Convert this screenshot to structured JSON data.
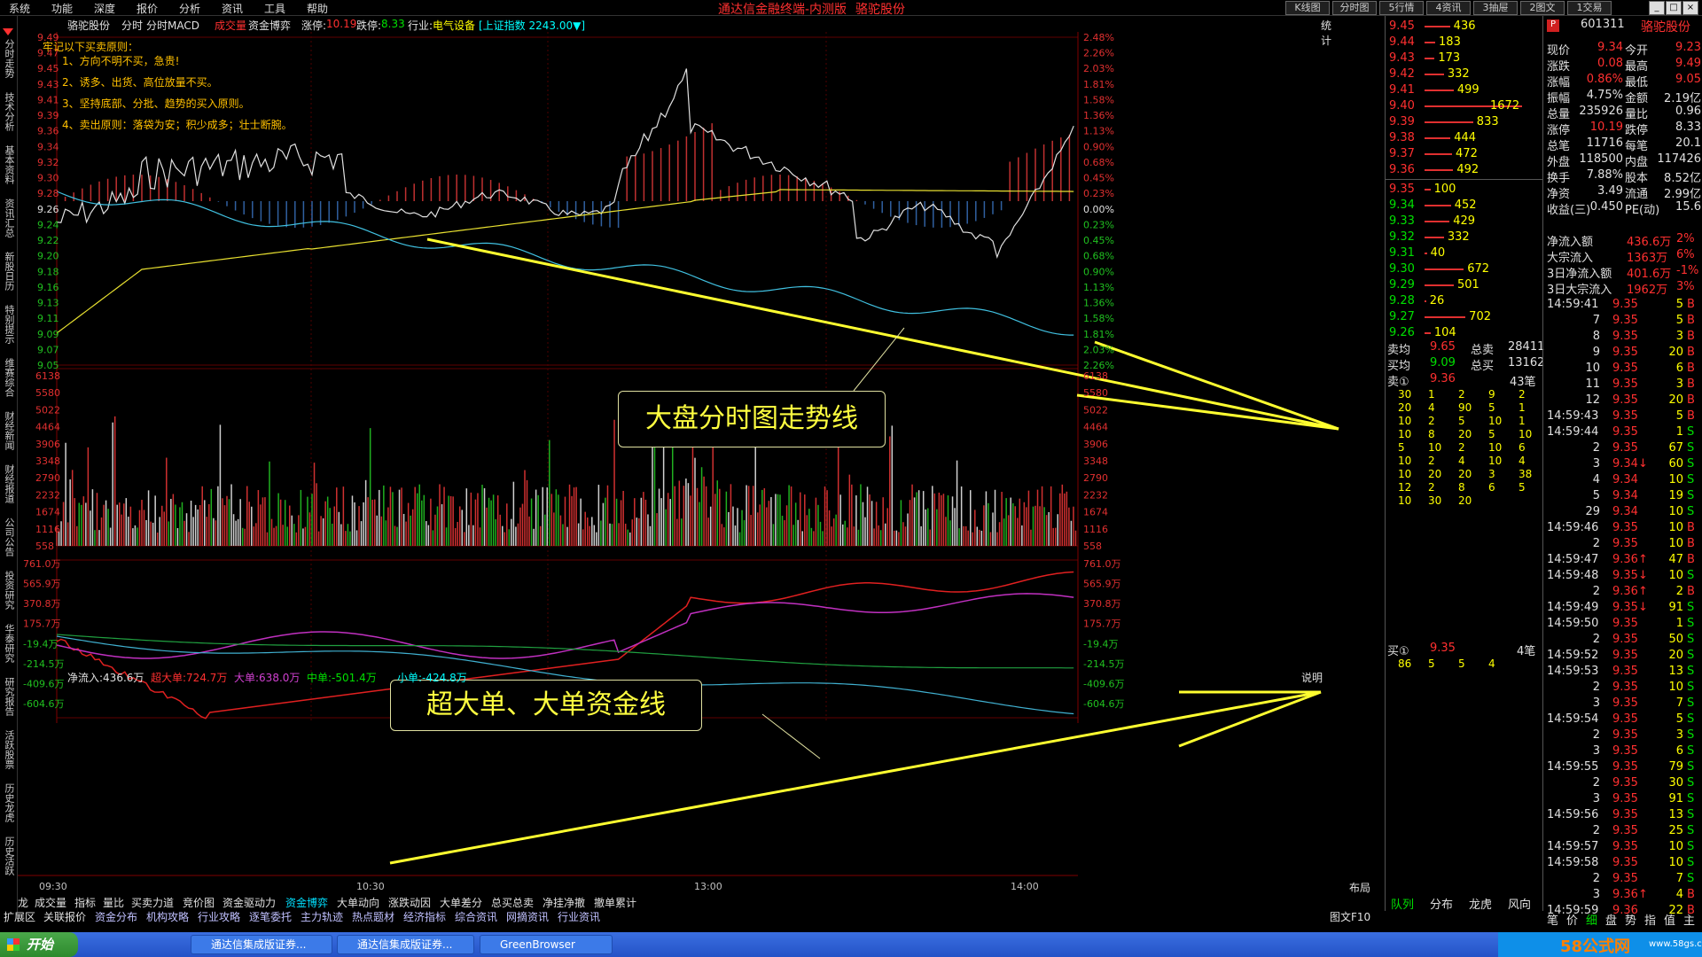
{
  "menu": [
    "系统",
    "功能",
    "深度",
    "报价",
    "分析",
    "资讯",
    "工具",
    "帮助"
  ],
  "window_title": "通达信金融终端-内测版",
  "window_stock": "骆驼股份",
  "toolbar_buttons": [
    "K线图",
    "分时图",
    "5行情",
    "4资讯",
    "3抽屉",
    "2图文",
    "1交易"
  ],
  "leftnav": [
    "分时走势",
    "技术分析",
    "基本资料",
    "资讯汇总",
    "新股日历",
    "特别提示",
    "维赛综合",
    "财经新闻",
    "财经报道",
    "公司公告",
    "投资研究",
    "华泰研究",
    "研究报告",
    "活跃股票",
    "历史龙虎",
    "历史活跃"
  ],
  "chart_header": {
    "stock": "骆驼股份",
    "items": [
      "分时",
      "分时MACD"
    ],
    "labels": [
      "成交量",
      "资金博弈"
    ],
    "zhangting_label": "涨停:",
    "zhangting": "10.19",
    "dieting_label": "跌停:",
    "dieting": "8.33",
    "industry_label": "行业:",
    "industry": "电气设备",
    "index_label": "[上证指数 2243.00▼]",
    "stats": "统计"
  },
  "annotations": {
    "title": "牢记以下买卖原则：",
    "lines": [
      "1、方向不明不买，急贵!",
      "2、诱多、出货、高位放量不买。",
      "3、坚持底部、分批、趋势的买入原则。",
      "4、卖出原则：落袋为安；积少成多；壮士断腕。"
    ]
  },
  "callouts": {
    "upper": "大盘分时图走势线",
    "lower": "超大单、大单资金线"
  },
  "price_axis": [
    "9.49",
    "9.47",
    "9.45",
    "9.43",
    "9.41",
    "9.39",
    "9.36",
    "9.34",
    "9.32",
    "9.30",
    "9.28",
    "9.26",
    "9.24",
    "9.22",
    "9.20",
    "9.18",
    "9.16",
    "9.13",
    "9.11",
    "9.09",
    "9.07",
    "9.05"
  ],
  "pct_axis": [
    "2.48%",
    "2.26%",
    "2.03%",
    "1.81%",
    "1.58%",
    "1.36%",
    "1.13%",
    "0.90%",
    "0.68%",
    "0.45%",
    "0.23%",
    "0.00%",
    "0.23%",
    "0.45%",
    "0.68%",
    "0.90%",
    "1.13%",
    "1.36%",
    "1.58%",
    "1.81%",
    "2.03%",
    "2.26%"
  ],
  "vol_axis": [
    "6138",
    "5580",
    "5022",
    "4464",
    "3906",
    "3348",
    "2790",
    "2232",
    "1674",
    "1116",
    "558"
  ],
  "flow_header": {
    "net": "净流入:436.6万",
    "super": "超大单:724.7万",
    "big": "大单:638.0万",
    "mid": "中单:-501.4万",
    "small": "小单:-424.8万",
    "explain": "说明"
  },
  "flow_axis": [
    "761.0万",
    "565.9万",
    "370.8万",
    "175.7万",
    "-19.4万",
    "-214.5万",
    "-409.6万",
    "-604.6万"
  ],
  "time_axis": [
    "09:30",
    "10:30",
    "13:00",
    "14:00"
  ],
  "layout_label": "布局",
  "order_book": {
    "sell": [
      [
        "9.45",
        "436"
      ],
      [
        "9.44",
        "183"
      ],
      [
        "9.43",
        "173"
      ],
      [
        "9.42",
        "332"
      ],
      [
        "9.41",
        "499"
      ],
      [
        "9.40",
        "1672"
      ],
      [
        "9.39",
        "833"
      ],
      [
        "9.38",
        "444"
      ],
      [
        "9.37",
        "472"
      ],
      [
        "9.36",
        "492"
      ]
    ],
    "buy": [
      [
        "9.35",
        "100"
      ],
      [
        "9.34",
        "452"
      ],
      [
        "9.33",
        "429"
      ],
      [
        "9.32",
        "332"
      ],
      [
        "9.31",
        "40"
      ],
      [
        "9.30",
        "672"
      ],
      [
        "9.29",
        "501"
      ],
      [
        "9.28",
        "26"
      ],
      [
        "9.27",
        "702"
      ],
      [
        "9.26",
        "104"
      ]
    ],
    "sell_avg_label": "卖均",
    "sell_avg": "9.65",
    "total_sell_label": "总卖",
    "total_sell": "28411",
    "buy_avg_label": "买均",
    "buy_avg": "9.09",
    "total_buy_label": "总买",
    "total_buy": "13162",
    "sell1_label": "卖①",
    "sell1_price": "9.36",
    "sell1_count": "43笔",
    "sell1_queue": [
      [
        "30",
        "1",
        "2",
        "9",
        "2"
      ],
      [
        "20",
        "4",
        "90",
        "5",
        "1"
      ],
      [
        "10",
        "2",
        "5",
        "10",
        "1"
      ],
      [
        "10",
        "8",
        "20",
        "5",
        "10"
      ],
      [
        "5",
        "10",
        "2",
        "10",
        "6"
      ],
      [
        "10",
        "2",
        "4",
        "10",
        "4"
      ],
      [
        "10",
        "20",
        "20",
        "3",
        "38"
      ],
      [
        "12",
        "2",
        "8",
        "6",
        "5"
      ],
      [
        "10",
        "30",
        "20",
        "",
        ""
      ]
    ],
    "buy1_label": "买①",
    "buy1_price": "9.35",
    "buy1_count": "4笔",
    "buy1_queue": [
      [
        "86",
        "5",
        "5",
        "4"
      ]
    ]
  },
  "quote": {
    "code": "601311",
    "name": "骆驼股份",
    "fields": [
      [
        "现价",
        "9.34",
        "今开",
        "9.23"
      ],
      [
        "涨跌",
        "0.08",
        "最高",
        "9.49"
      ],
      [
        "涨幅",
        "0.86%",
        "最低",
        "9.05"
      ],
      [
        "振幅",
        "4.75%",
        "金额",
        "2.19亿"
      ],
      [
        "总量",
        "235926",
        "量比",
        "0.96"
      ],
      [
        "涨停",
        "10.19",
        "跌停",
        "8.33"
      ],
      [
        "总笔",
        "11716",
        "每笔",
        "20.1"
      ],
      [
        "外盘",
        "118500",
        "内盘",
        "117426"
      ],
      [
        "换手",
        "7.88%",
        "股本",
        "8.52亿"
      ],
      [
        "净资",
        "3.49",
        "流通",
        "2.99亿"
      ],
      [
        "收益(三)",
        "0.450",
        "PE(动)",
        "15.6"
      ]
    ],
    "flows": [
      [
        "净流入额",
        "436.6万",
        "2%"
      ],
      [
        "大宗流入",
        "1363万",
        "6%"
      ],
      [
        "3日净流入额",
        "401.6万",
        "-1%"
      ],
      [
        "3日大宗流入",
        "1962万",
        "3%"
      ]
    ],
    "ticks": [
      [
        "14:59:41",
        "9.35",
        "5",
        "B"
      ],
      [
        "7",
        "9.35",
        "5",
        "B"
      ],
      [
        "8",
        "9.35",
        "3",
        "B"
      ],
      [
        "9",
        "9.35",
        "20",
        "B"
      ],
      [
        "10",
        "9.35",
        "6",
        "B"
      ],
      [
        "11",
        "9.35",
        "3",
        "B"
      ],
      [
        "12",
        "9.35",
        "20",
        "B"
      ],
      [
        "14:59:43",
        "9.35",
        "5",
        "B"
      ],
      [
        "14:59:44",
        "9.35",
        "1",
        "S"
      ],
      [
        "2",
        "9.35",
        "67",
        "S"
      ],
      [
        "3",
        "9.34↓",
        "60",
        "S"
      ],
      [
        "4",
        "9.34",
        "10",
        "S"
      ],
      [
        "5",
        "9.34",
        "19",
        "S"
      ],
      [
        "29",
        "9.34",
        "10",
        "S"
      ],
      [
        "14:59:46",
        "9.35",
        "10",
        "B"
      ],
      [
        "2",
        "9.35",
        "10",
        "B"
      ],
      [
        "14:59:47",
        "9.36↑",
        "47",
        "B"
      ],
      [
        "14:59:48",
        "9.35↓",
        "10",
        "S"
      ],
      [
        "2",
        "9.36↑",
        "2",
        "B"
      ],
      [
        "14:59:49",
        "9.35↓",
        "91",
        "S"
      ],
      [
        "14:59:50",
        "9.35",
        "1",
        "S"
      ],
      [
        "2",
        "9.35",
        "50",
        "S"
      ],
      [
        "14:59:52",
        "9.35",
        "20",
        "S"
      ],
      [
        "14:59:53",
        "9.35",
        "13",
        "S"
      ],
      [
        "2",
        "9.35",
        "10",
        "S"
      ],
      [
        "3",
        "9.35",
        "7",
        "S"
      ],
      [
        "14:59:54",
        "9.35",
        "5",
        "S"
      ],
      [
        "2",
        "9.35",
        "3",
        "S"
      ],
      [
        "3",
        "9.35",
        "6",
        "S"
      ],
      [
        "14:59:55",
        "9.35",
        "79",
        "S"
      ],
      [
        "2",
        "9.35",
        "30",
        "S"
      ],
      [
        "3",
        "9.35",
        "91",
        "S"
      ],
      [
        "14:59:56",
        "9.35",
        "13",
        "S"
      ],
      [
        "2",
        "9.35",
        "25",
        "S"
      ],
      [
        "14:59:57",
        "9.35",
        "10",
        "S"
      ],
      [
        "14:59:58",
        "9.35",
        "10",
        "S"
      ],
      [
        "2",
        "9.35",
        "7",
        "S"
      ],
      [
        "3",
        "9.36↑",
        "4",
        "B"
      ],
      [
        "14:59:59",
        "9.36",
        "22",
        "B"
      ]
    ]
  },
  "panel_tabs": [
    "队列",
    "分布",
    "龙虎",
    "风向"
  ],
  "quote_tabs": [
    "笔",
    "价",
    "细",
    "盘",
    "势",
    "指",
    "值",
    "主"
  ],
  "bottom_tabs1": [
    "龙",
    "成交量",
    "指标",
    "量比",
    "买卖力道",
    "竞价图",
    "资金驱动力",
    "资金博弈",
    "大单动向",
    "涨跌动因",
    "大单差分",
    "总买总卖",
    "净挂净撤",
    "撤单累计"
  ],
  "bottom_tabs2": [
    "扩展区",
    "关联报价",
    "资金分布",
    "机构攻略",
    "行业攻略",
    "逐笔委托",
    "主力轨迹",
    "热点题材",
    "经济指标",
    "综合资讯",
    "网摘资讯",
    "行业资讯"
  ],
  "bottom_right": "图文F10",
  "taskbar": {
    "start": "开始",
    "tasks": [
      "通达信集成版证券...",
      "通达信集成版证券...",
      "GreenBrowser"
    ],
    "watermark": "58公式网",
    "watermark_url": "www.58gs.com"
  }
}
